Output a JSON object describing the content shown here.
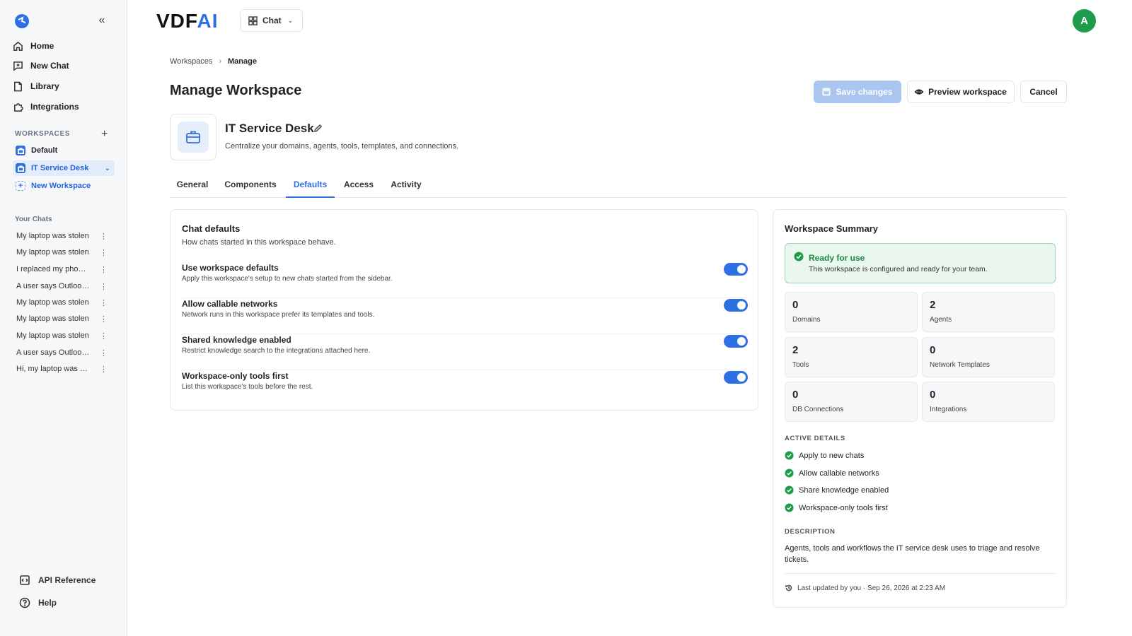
{
  "sidebar": {
    "collapse_label": "«",
    "nav": [
      {
        "label": "Home",
        "icon": "home-icon"
      },
      {
        "label": "New Chat",
        "icon": "new-chat-icon"
      },
      {
        "label": "Library",
        "icon": "library-icon"
      },
      {
        "label": "Integrations",
        "icon": "integrations-icon"
      }
    ],
    "workspaces_label": "WORKSPACES",
    "add_label": "+",
    "workspaces": [
      {
        "label": "Default",
        "active": false
      },
      {
        "label": "IT Service Desk",
        "active": true
      }
    ],
    "new_workspace_label": "New Workspace",
    "chats_label": "Your Chats",
    "chats": [
      "My laptop was stolen",
      "My laptop was stolen",
      "I replaced my phone and",
      "A user says Outlook is",
      "My laptop was stolen",
      "My laptop was stolen",
      "My laptop was stolen",
      "A user says Outlook is",
      "Hi, my laptop was stolen"
    ],
    "chat_more": "⋮",
    "footer": [
      {
        "label": "API Reference",
        "icon": "api-reference-icon"
      },
      {
        "label": "Help",
        "icon": "help-icon"
      }
    ]
  },
  "topbar": {
    "brand_main": "VDF",
    "brand_accent": "AI",
    "mode_label": "Chat",
    "avatar_initial": "A"
  },
  "header": {
    "breadcrumb": [
      "Workspaces",
      "Manage"
    ],
    "breadcrumb_sep": "›",
    "title": "Manage Workspace",
    "save_label": "Save changes",
    "preview_label": "Preview workspace",
    "cancel_label": "Cancel"
  },
  "workspace": {
    "name": "IT Service Desk",
    "description": "Centralize your domains, agents, tools, templates, and connections."
  },
  "tabs": [
    "General",
    "Components",
    "Defaults",
    "Access",
    "Activity"
  ],
  "active_tab": "Defaults",
  "chat_defaults": {
    "title": "Chat defaults",
    "subtitle": "How chats started in this workspace behave.",
    "settings": [
      {
        "title": "Use workspace defaults",
        "desc": "Apply this workspace's setup to new chats started from the sidebar.",
        "enabled": true
      },
      {
        "title": "Allow callable networks",
        "desc": "Network runs in this workspace prefer its templates and tools.",
        "enabled": true
      },
      {
        "title": "Shared knowledge enabled",
        "desc": "Restrict knowledge search to the integrations attached here.",
        "enabled": true
      },
      {
        "title": "Workspace-only tools first",
        "desc": "List this workspace's tools before the rest.",
        "enabled": true
      }
    ]
  },
  "summary": {
    "title": "Workspace Summary",
    "ready_title": "Ready for use",
    "ready_desc": "This workspace is configured and ready for your team.",
    "stats": [
      {
        "value": "0",
        "label": "Domains"
      },
      {
        "value": "2",
        "label": "Agents"
      },
      {
        "value": "2",
        "label": "Tools"
      },
      {
        "value": "0",
        "label": "Network Templates"
      },
      {
        "value": "0",
        "label": "DB Connections"
      },
      {
        "value": "0",
        "label": "Integrations"
      }
    ],
    "active_label": "ACTIVE DETAILS",
    "active_details": [
      "Apply to new chats",
      "Allow callable networks",
      "Share knowledge enabled",
      "Workspace-only tools first"
    ],
    "description_label": "DESCRIPTION",
    "description": "Agents, tools and workflows the IT service desk uses to triage and resolve tickets.",
    "updated": "Last updated by you · Sep 26, 2026 at 2:23 AM"
  },
  "colors": {
    "accent": "#2f6fe4",
    "success": "#1e9b4b",
    "avatar": "#1e9b4b"
  }
}
